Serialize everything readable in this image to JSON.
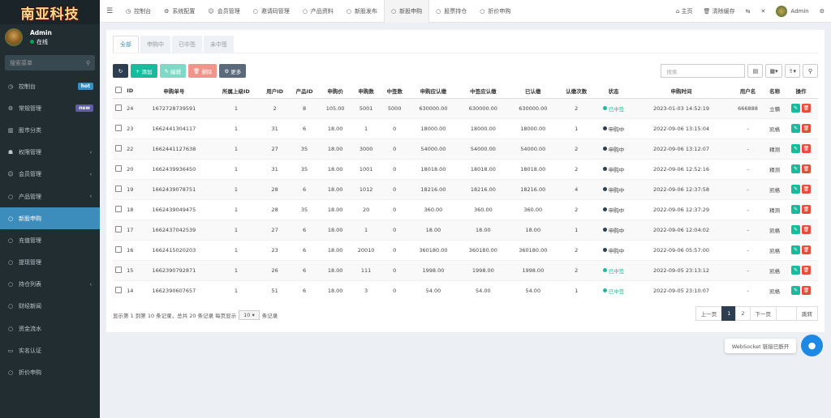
{
  "logo": {
    "text": "南亚科技"
  },
  "user": {
    "name": "Admin",
    "status": "在线"
  },
  "sidebar": {
    "search_placeholder": "搜索菜单",
    "items": [
      {
        "label": "控制台",
        "badge": "hot"
      },
      {
        "label": "常规管理",
        "badge": "new"
      },
      {
        "label": "股市分类"
      },
      {
        "label": "权限管理"
      },
      {
        "label": "会员管理"
      },
      {
        "label": "产品管理"
      },
      {
        "label": "新股申购"
      },
      {
        "label": "充值管理"
      },
      {
        "label": "提现管理"
      },
      {
        "label": "持仓列表"
      },
      {
        "label": "财经新闻"
      },
      {
        "label": "资金流水"
      },
      {
        "label": "实名认证"
      },
      {
        "label": "折价申购"
      }
    ]
  },
  "topbar": {
    "tabs": [
      "控制台",
      "系统配置",
      "会员管理",
      "邀请码管理",
      "产品资料",
      "新股发布",
      "新股申购",
      "股票持仓",
      "折价申购"
    ],
    "home": "主页",
    "clear_cache": "清除缓存",
    "admin": "Admin"
  },
  "subtabs": [
    "全部",
    "申购中",
    "已中签",
    "未中签"
  ],
  "toolbar": {
    "add": "添加",
    "edit": "编辑",
    "delete": "删除",
    "more": "更多",
    "search_placeholder": "搜索"
  },
  "table": {
    "headers": [
      "ID",
      "申购单号",
      "所属上级ID",
      "用户ID",
      "产品ID",
      "申购价",
      "申购数",
      "中签数",
      "申购应认缴",
      "中签应认缴",
      "已认缴",
      "认缴次数",
      "状态",
      "申购时间",
      "用户名",
      "名称",
      "操作"
    ],
    "rows": [
      [
        "24",
        "1672728739591",
        "1",
        "2",
        "8",
        "105.00",
        "5001",
        "5000",
        "630000.00",
        "630000.00",
        "630000.00",
        "2",
        "已中签",
        "2023-01-03 14:52:19",
        "666888",
        "立積"
      ],
      [
        "23",
        "1662441304117",
        "1",
        "31",
        "6",
        "18.00",
        "1",
        "0",
        "18000.00",
        "18000.00",
        "18000.00",
        "1",
        "申购中",
        "2022-09-06 13:15:04",
        "-",
        "凯格"
      ],
      [
        "22",
        "1662441127638",
        "1",
        "27",
        "35",
        "18.00",
        "3000",
        "0",
        "54000.00",
        "54000.00",
        "54000.00",
        "2",
        "申购中",
        "2022-09-06 13:12:07",
        "-",
        "精测"
      ],
      [
        "20",
        "1662439936450",
        "1",
        "31",
        "35",
        "18.00",
        "1001",
        "0",
        "18018.00",
        "18018.00",
        "18018.00",
        "2",
        "申购中",
        "2022-09-06 12:52:16",
        "-",
        "精测"
      ],
      [
        "19",
        "1662439078751",
        "1",
        "28",
        "6",
        "18.00",
        "1012",
        "0",
        "18216.00",
        "18216.00",
        "18216.00",
        "4",
        "申购中",
        "2022-09-06 12:37:58",
        "-",
        "凯格"
      ],
      [
        "18",
        "1662439049475",
        "1",
        "28",
        "35",
        "18.00",
        "20",
        "0",
        "360.00",
        "360.00",
        "360.00",
        "2",
        "申购中",
        "2022-09-06 12:37:29",
        "-",
        "精测"
      ],
      [
        "17",
        "1662437042539",
        "1",
        "27",
        "6",
        "18.00",
        "1",
        "0",
        "18.00",
        "18.00",
        "18.00",
        "1",
        "申购中",
        "2022-09-06 12:04:02",
        "-",
        "凯格"
      ],
      [
        "16",
        "1662415020203",
        "1",
        "23",
        "6",
        "18.00",
        "20010",
        "0",
        "360180.00",
        "360180.00",
        "360180.00",
        "2",
        "申购中",
        "2022-09-06 05:57:00",
        "-",
        "凯格"
      ],
      [
        "15",
        "1662390792871",
        "1",
        "26",
        "6",
        "18.00",
        "111",
        "0",
        "1998.00",
        "1998.00",
        "1998.00",
        "2",
        "已中签",
        "2022-09-05 23:13:12",
        "-",
        "凯格"
      ],
      [
        "14",
        "1662390607657",
        "1",
        "51",
        "6",
        "18.00",
        "3",
        "0",
        "54.00",
        "54.00",
        "54.00",
        "1",
        "已中签",
        "2022-09-05 23:10:07",
        "-",
        "凯格"
      ]
    ]
  },
  "pagination": {
    "info_prefix": "显示第 1 到第 10 条记录，总共 20 条记录 每页显示",
    "page_size": "10",
    "info_suffix": "条记录",
    "prev": "上一页",
    "pages": [
      "1",
      "2"
    ],
    "next": "下一页",
    "jump": "跳转"
  },
  "websocket": {
    "text": "WebSocket 链接已断开"
  }
}
